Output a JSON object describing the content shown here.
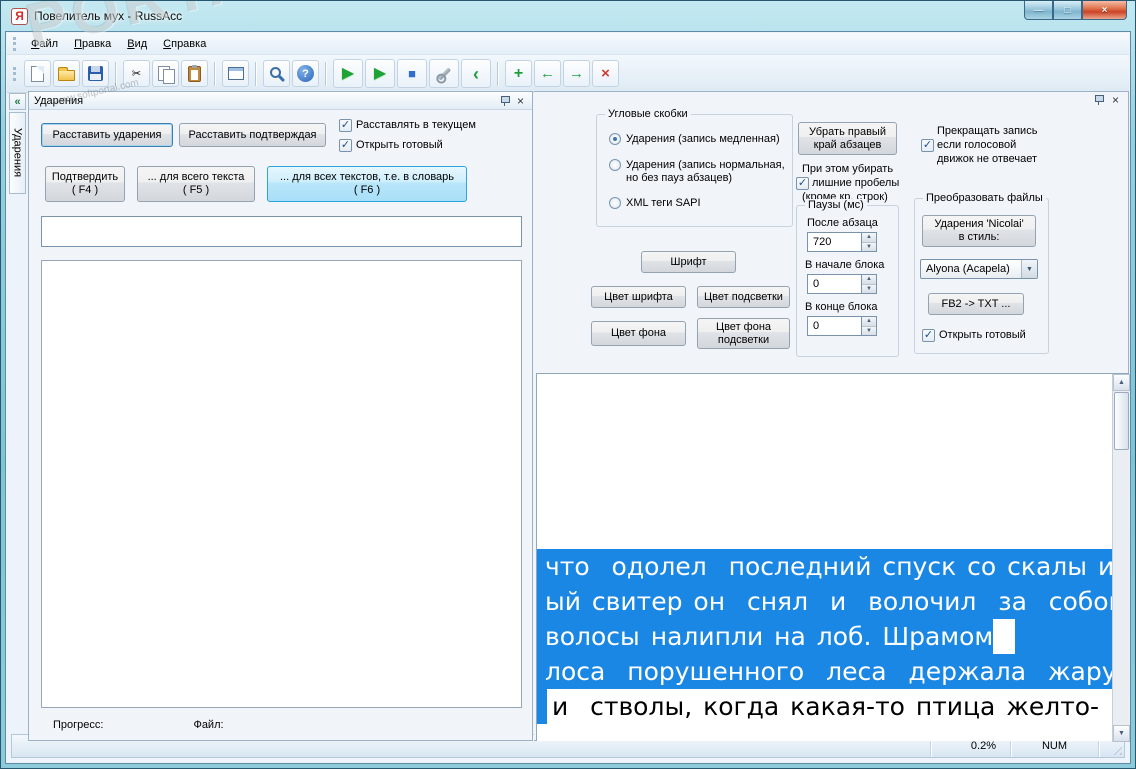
{
  "window": {
    "title": "Повелитель мух - RussAcc"
  },
  "colors": {
    "selection_blue": "#1B87E5",
    "frame_aqua": "#8FCBD9",
    "close_red": "#CC4326",
    "panel_bg": "#F1F5FA"
  },
  "icons": {
    "app": "Я",
    "minimize": "—",
    "maximize": "□",
    "close": "×",
    "panel_close": "×",
    "collapse_chevron": "«",
    "scissors": "✂",
    "help": "?",
    "play": "▶",
    "stop": "■",
    "back": "‹",
    "plus": "+",
    "arrow_left": "←",
    "arrow_right": "→",
    "delete_x": "×",
    "check": "✓",
    "dropdown": "▼",
    "spin_up": "▲",
    "spin_down": "▼",
    "scroll_up": "▲",
    "scroll_down": "▼"
  },
  "menu": {
    "items": [
      "Файл",
      "Правка",
      "Вид",
      "Справка"
    ]
  },
  "side_tab": {
    "label": "Ударения"
  },
  "left_panel": {
    "title": "Ударения",
    "btn_place": "Расставить ударения",
    "btn_place_confirm": "Расставить подтверждая",
    "cb_current": "Расставлять в текущем",
    "cb_open_ready": "Открыть готовый",
    "btn_confirm": "Подтвердить\n( F4 )",
    "btn_all_text": "... для всего текста\n( F5 )",
    "btn_all_texts": "... для всех текстов, т.е. в словарь\n( F6 )",
    "input_value": "",
    "progress_label": "Прогресс:",
    "file_label": "Файл:"
  },
  "settings": {
    "group_brackets": {
      "title": "Угловые скобки",
      "radio1": "Ударения (запись медленная)",
      "radio2": "Ударения (запись нормальная,\nно без пауз абзацев)",
      "radio3": "XML теги SAPI"
    },
    "btn_remove_right": "Убрать правый\nкрай абзацев",
    "cb_stop_engine": {
      "line1": "Прекращать запись",
      "line2": "если голосовой",
      "line3": "движок не отвечает",
      "checked": true
    },
    "cb_trim_spaces": {
      "line1": "При этом убирать",
      "line2": "лишние пробелы",
      "line3": "(кроме кр. строк)",
      "checked": true
    },
    "group_pauses": {
      "title": "Паузы (мс)",
      "after_par_label": "После абзаца",
      "after_par_value": "720",
      "block_start_label": "В начале блока",
      "block_start_value": "0",
      "block_end_label": "В конце блока",
      "block_end_value": "0"
    },
    "btn_font": "Шрифт",
    "btn_font_color": "Цвет шрифта",
    "btn_hl_color": "Цвет подсветки",
    "btn_bg_color": "Цвет фона",
    "btn_hl_bg_color": "Цвет фона\nподсветки",
    "group_convert": {
      "title": "Преобразовать файлы",
      "btn_nicolai": "Ударения 'Nicolai'\nв стиль:",
      "voice_value": "Alyona (Acapela)",
      "btn_fb2": "FB2 -> TXT ...",
      "cb_open_ready": "Открыть готовый",
      "cb_open_ready_checked": true
    }
  },
  "editor": {
    "line1": "что  одолел  последний спуск со скалы и",
    "line2": "ый свитер он  снял  и  волочил  за  собой,",
    "line3": "волосы налипли на лоб. Шрамом",
    "line4": "лоса  порушенного  леса  держала  жару,",
    "line5": "и  стволы, когда какая-то птица желто-"
  },
  "statusbar": {
    "progress": "0.2%",
    "num": "NUM"
  },
  "watermark": {
    "big": "PORTAL",
    "url": "www.softportal.com"
  }
}
